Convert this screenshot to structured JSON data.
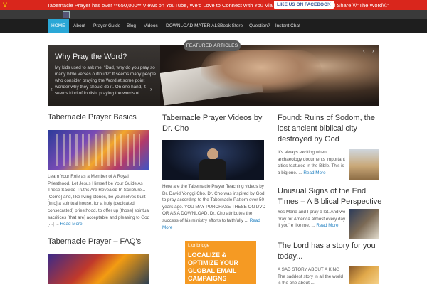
{
  "topbar": {
    "message": "Tabernacle Prayer has over **650,000** Views on YouTube, We'd Love to Connect with You Via Email or Facebook!",
    "facebook_button": "LIKE US ON FACEBOOK",
    "share": "And Share \\\\\\\"The Word\\\\\\\""
  },
  "nav": {
    "items": [
      "HOME",
      "About",
      "Prayer Guide",
      "Blog",
      "Videos",
      "DOWNLOAD MATERIALS",
      "Book Store",
      "Question? – Instant Chat"
    ]
  },
  "slider": {
    "badge": "FEATURED ARTICLES",
    "title": "Why Pray the Word?",
    "excerpt": "My kids used to ask me, “Dad, why do you pray so many bible verses outloud?” It seems many people who consider praying the Word at some point wonder why they should do it. On one hand, it seems kind of foolish, praying the words of..."
  },
  "posts": {
    "p1": {
      "title": "Tabernacle Prayer Basics",
      "excerpt": "Learn Your Role as a Member of A Royal Priesthood. Let Jesus Himself be Your Guide As These Sacred Truths Are Revealed In Scripture... [Come] and, like living stones, be yourselves built [into] a spiritual house, for a holy (dedicated, consecrated) priesthood, to offer up [those] spiritual sacrifices [that are] acceptable and pleasing to God [...] ...",
      "more": "Read More"
    },
    "p2": {
      "title": "Tabernacle Prayer Videos by Dr. Cho",
      "excerpt": "Here are the Tabernacle Prayer Teaching videos by Dr. David Yonggi Cho.  Dr. Cho was inspired by God to pray according to the Tabernacle Pattern over 50 years ago.  YOU MAY PURCHASE THESE ON DVD OR AS A DOWNLOAD.  Dr. Cho attributes the success of his ministry efforts to faithfully ...",
      "more": "Read More"
    },
    "p3": {
      "title": "Found: Ruins of Sodom, the lost ancient biblical city destroyed by God",
      "excerpt": "It's always exciting when archaeology documents important cities featured in the Bible.  This is a big one. ...",
      "more": "Read More"
    },
    "p4": {
      "title": "Unusual Signs of the End Times – A Biblical Perspective",
      "excerpt": "Yes Marie and I pray a lot.  And we pray for America almost every day.  If you're like me, ...",
      "more": "Read More"
    },
    "p5": {
      "title": "Tabernacle Prayer – FAQ's"
    },
    "p6": {
      "title": "The Lord has a story for you today...",
      "excerpt": "A SAD STORY ABOUT A KING The saddest story in all the world is the one about ..."
    }
  },
  "ad": {
    "brand": "Lionbridge",
    "lines": [
      "LOCALIZE &",
      "OPTIMIZE YOUR",
      "GLOBAL EMAIL",
      "CAMPAIGNS"
    ]
  },
  "colors": {
    "topbar": "#d9261c",
    "nav_active": "#2aa7d6",
    "link": "#1f7fc0",
    "ad_orange": "#f59a23"
  }
}
